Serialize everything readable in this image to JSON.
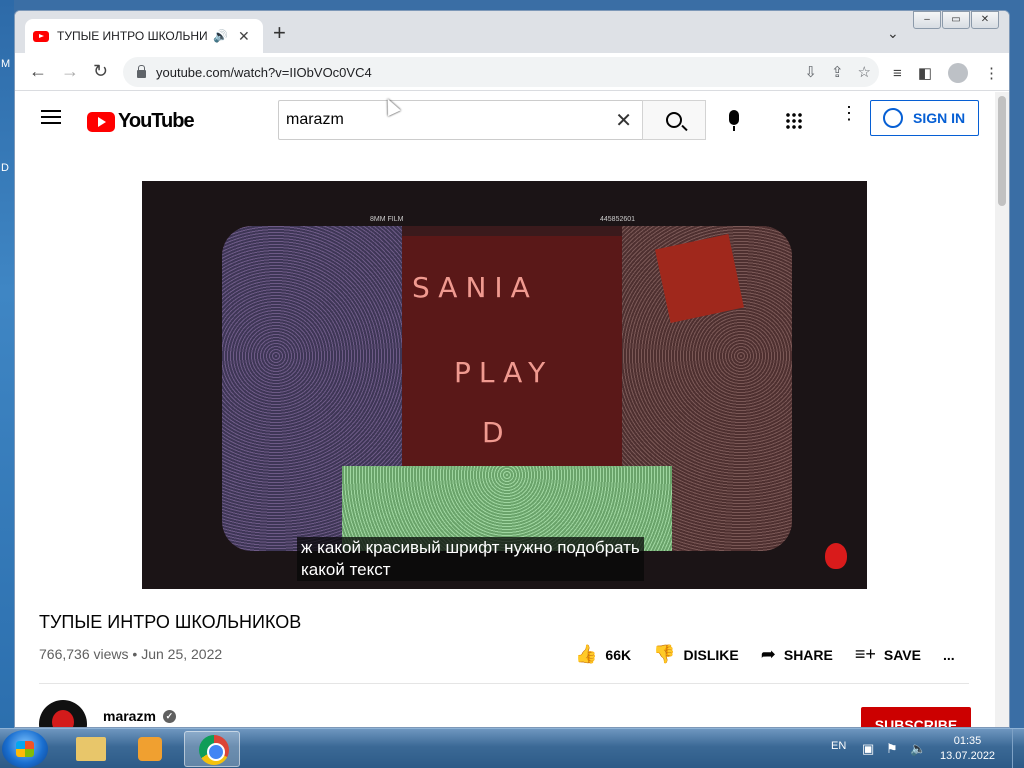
{
  "desktop": {
    "letters": [
      "M",
      "D"
    ]
  },
  "browser": {
    "tab_title": "ТУПЫЕ ИНТРО ШКОЛЬНИКОВ - YouTube",
    "url": "youtube.com/watch?v=IIObVOc0VC4"
  },
  "youtube": {
    "logo_text": "YouTube",
    "search_value": "marazm",
    "sign_in_label": "SIGN IN"
  },
  "video": {
    "subtitle_line1": "ж какой красивый шрифт нужно подобрать",
    "subtitle_line2": "какой текст",
    "hud_left": "8MM FILM",
    "hud_right": "445852601",
    "scene_text_1": "SANIA",
    "scene_text_2": "PLAY",
    "scene_text_3": "D",
    "title": "ТУПЫЕ ИНТРО ШКОЛЬНИКОВ",
    "views": "766,736 views",
    "date": "Jun 25, 2022",
    "meta_separator": " • ",
    "likes": "66K",
    "dislike_label": "DISLIKE",
    "share_label": "SHARE",
    "save_label": "SAVE",
    "more_label": "..."
  },
  "channel": {
    "name": "marazm",
    "subscribe_label": "SUBSCRIBE"
  },
  "taskbar": {
    "language": "EN",
    "time": "01:35",
    "date": "13.07.2022"
  }
}
